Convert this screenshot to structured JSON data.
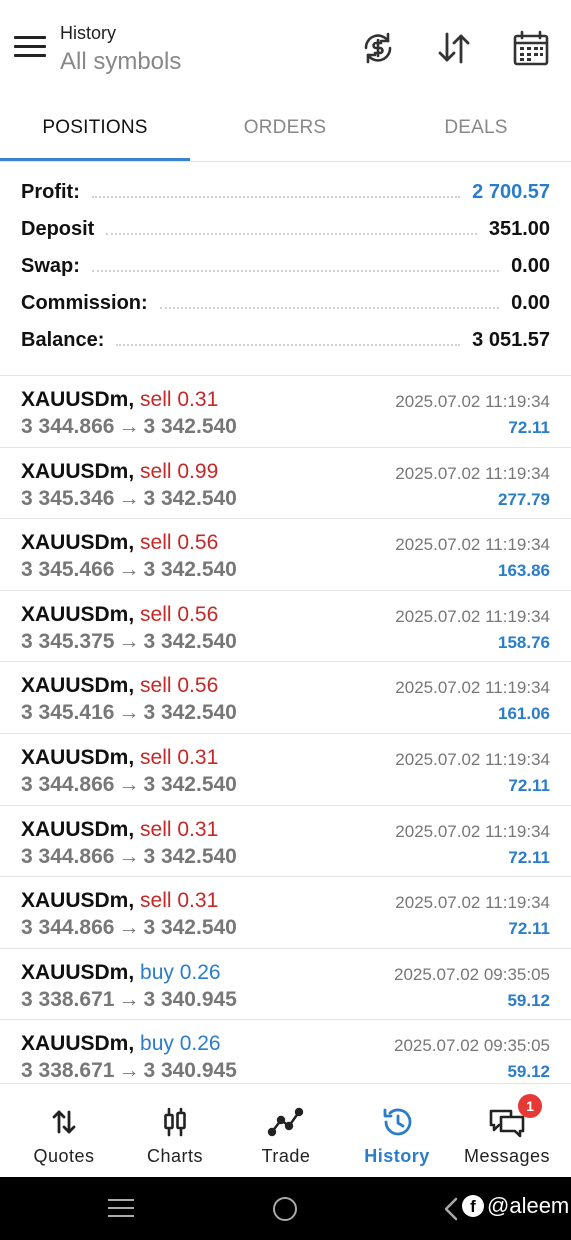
{
  "header": {
    "subtitle": "History",
    "title": "All symbols"
  },
  "tabs": [
    {
      "label": "POSITIONS",
      "active": true
    },
    {
      "label": "ORDERS",
      "active": false
    },
    {
      "label": "DEALS",
      "active": false
    }
  ],
  "summary": [
    {
      "label": "Profit:",
      "value": "2 700.57",
      "highlight": true
    },
    {
      "label": "Deposit",
      "value": "351.00",
      "highlight": false
    },
    {
      "label": "Swap:",
      "value": "0.00",
      "highlight": false
    },
    {
      "label": "Commission:",
      "value": "0.00",
      "highlight": false
    },
    {
      "label": "Balance:",
      "value": "3 051.57",
      "highlight": false
    }
  ],
  "positions": [
    {
      "symbol": "XAUUSDm,",
      "type": "sell 0.31",
      "side": "sell",
      "open": "3 344.866",
      "close": "3 342.540",
      "time": "2025.07.02 11:19:34",
      "profit": "72.11"
    },
    {
      "symbol": "XAUUSDm,",
      "type": "sell 0.99",
      "side": "sell",
      "open": "3 345.346",
      "close": "3 342.540",
      "time": "2025.07.02 11:19:34",
      "profit": "277.79"
    },
    {
      "symbol": "XAUUSDm,",
      "type": "sell 0.56",
      "side": "sell",
      "open": "3 345.466",
      "close": "3 342.540",
      "time": "2025.07.02 11:19:34",
      "profit": "163.86"
    },
    {
      "symbol": "XAUUSDm,",
      "type": "sell 0.56",
      "side": "sell",
      "open": "3 345.375",
      "close": "3 342.540",
      "time": "2025.07.02 11:19:34",
      "profit": "158.76"
    },
    {
      "symbol": "XAUUSDm,",
      "type": "sell 0.56",
      "side": "sell",
      "open": "3 345.416",
      "close": "3 342.540",
      "time": "2025.07.02 11:19:34",
      "profit": "161.06"
    },
    {
      "symbol": "XAUUSDm,",
      "type": "sell 0.31",
      "side": "sell",
      "open": "3 344.866",
      "close": "3 342.540",
      "time": "2025.07.02 11:19:34",
      "profit": "72.11"
    },
    {
      "symbol": "XAUUSDm,",
      "type": "sell 0.31",
      "side": "sell",
      "open": "3 344.866",
      "close": "3 342.540",
      "time": "2025.07.02 11:19:34",
      "profit": "72.11"
    },
    {
      "symbol": "XAUUSDm,",
      "type": "sell 0.31",
      "side": "sell",
      "open": "3 344.866",
      "close": "3 342.540",
      "time": "2025.07.02 11:19:34",
      "profit": "72.11"
    },
    {
      "symbol": "XAUUSDm,",
      "type": "buy 0.26",
      "side": "buy",
      "open": "3 338.671",
      "close": "3 340.945",
      "time": "2025.07.02 09:35:05",
      "profit": "59.12"
    },
    {
      "symbol": "XAUUSDm,",
      "type": "buy 0.26",
      "side": "buy",
      "open": "3 338.671",
      "close": "3 340.945",
      "time": "2025.07.02 09:35:05",
      "profit": "59.12"
    }
  ],
  "arrow": "→",
  "nav": [
    {
      "label": "Quotes",
      "icon": "quotes-icon",
      "active": false
    },
    {
      "label": "Charts",
      "icon": "charts-icon",
      "active": false
    },
    {
      "label": "Trade",
      "icon": "trade-icon",
      "active": false
    },
    {
      "label": "History",
      "icon": "history-icon",
      "active": true
    },
    {
      "label": "Messages",
      "icon": "messages-icon",
      "active": false,
      "badge": "1"
    }
  ],
  "watermark": "@aleem",
  "colors": {
    "accent": "#2a7dc9",
    "sell": "#c62828",
    "buy": "#2a7dc9",
    "badge": "#e53935"
  }
}
